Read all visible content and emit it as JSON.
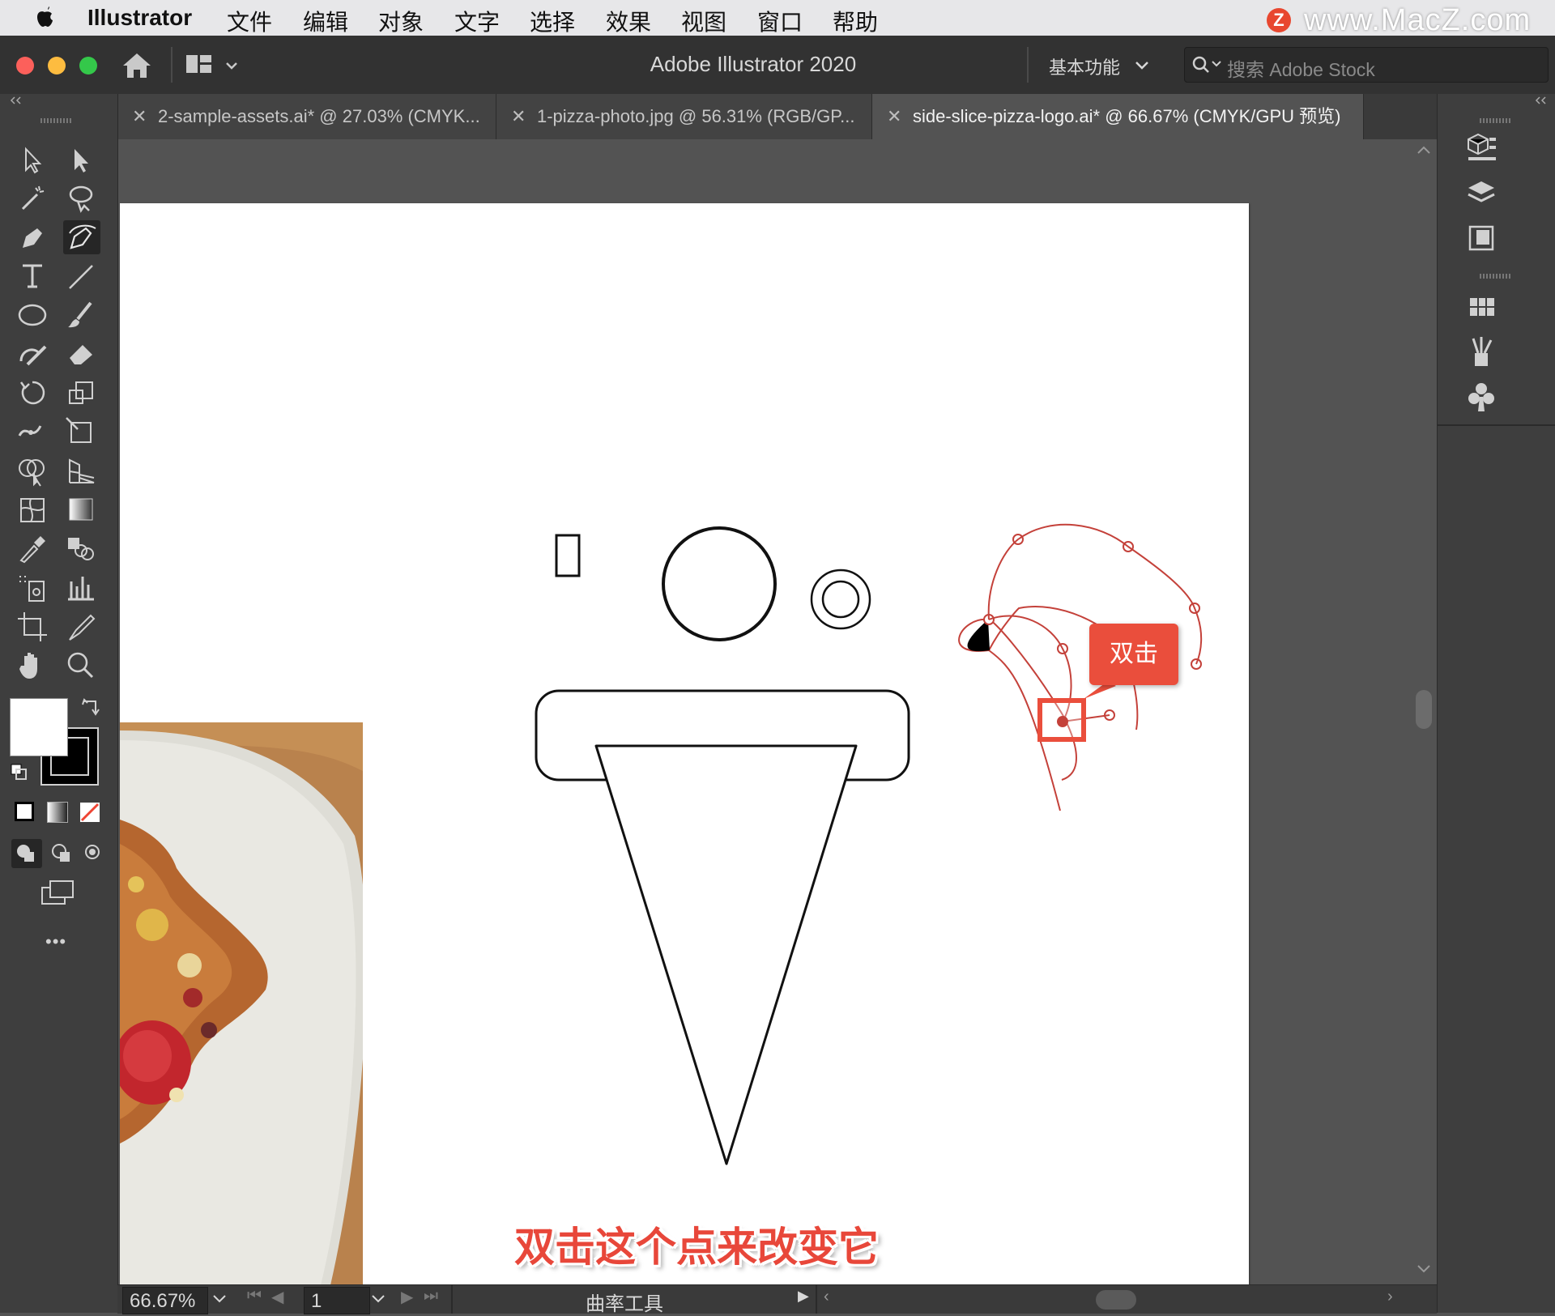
{
  "menubar": {
    "app_name": "Illustrator",
    "items": [
      "文件",
      "编辑",
      "对象",
      "文字",
      "选择",
      "效果",
      "视图",
      "窗口",
      "帮助"
    ]
  },
  "watermark": {
    "logo": "Z",
    "text": "www.MacZ.com"
  },
  "appbar": {
    "title": "Adobe Illustrator 2020",
    "workspace": "基本功能",
    "search_placeholder": "搜索 Adobe Stock"
  },
  "tabs": [
    {
      "label": "2-sample-assets.ai* @ 27.03% (CMYK...",
      "active": false
    },
    {
      "label": "1-pizza-photo.jpg @ 56.31% (RGB/GP...",
      "active": false
    },
    {
      "label": "side-slice-pizza-logo.ai* @ 66.67% (CMYK/GPU 预览)",
      "active": true
    }
  ],
  "toolbar": {
    "tools": [
      "selection-tool",
      "direct-selection-tool",
      "magic-wand-tool",
      "lasso-tool",
      "pen-tool",
      "curvature-tool",
      "type-tool",
      "line-segment-tool",
      "ellipse-tool",
      "paintbrush-tool",
      "shaper-tool",
      "eraser-tool",
      "rotate-tool",
      "scale-tool",
      "width-tool",
      "free-transform-tool",
      "shape-builder-tool",
      "perspective-grid-tool",
      "mesh-tool",
      "gradient-tool",
      "eyedropper-tool",
      "blend-tool",
      "symbol-sprayer-tool",
      "column-graph-tool",
      "artboard-tool",
      "slice-tool",
      "hand-tool",
      "zoom-tool"
    ],
    "selected_tool": "curvature-tool",
    "more_label": "•••"
  },
  "right_panel": {
    "icons": [
      "properties-icon",
      "layers-icon",
      "libraries-icon",
      "swatches-icon",
      "brushes-icon",
      "symbols-icon"
    ]
  },
  "canvas": {
    "callout_label": "双击",
    "caption": "双击这个点来改变它"
  },
  "statusbar": {
    "zoom": "66.67%",
    "artboard_number": "1",
    "tool_name": "曲率工具"
  },
  "colors": {
    "accent": "#ea4e3c",
    "path_stroke": "#c4413a",
    "ui_dark": "#323232",
    "panel": "#3e3e3e"
  }
}
